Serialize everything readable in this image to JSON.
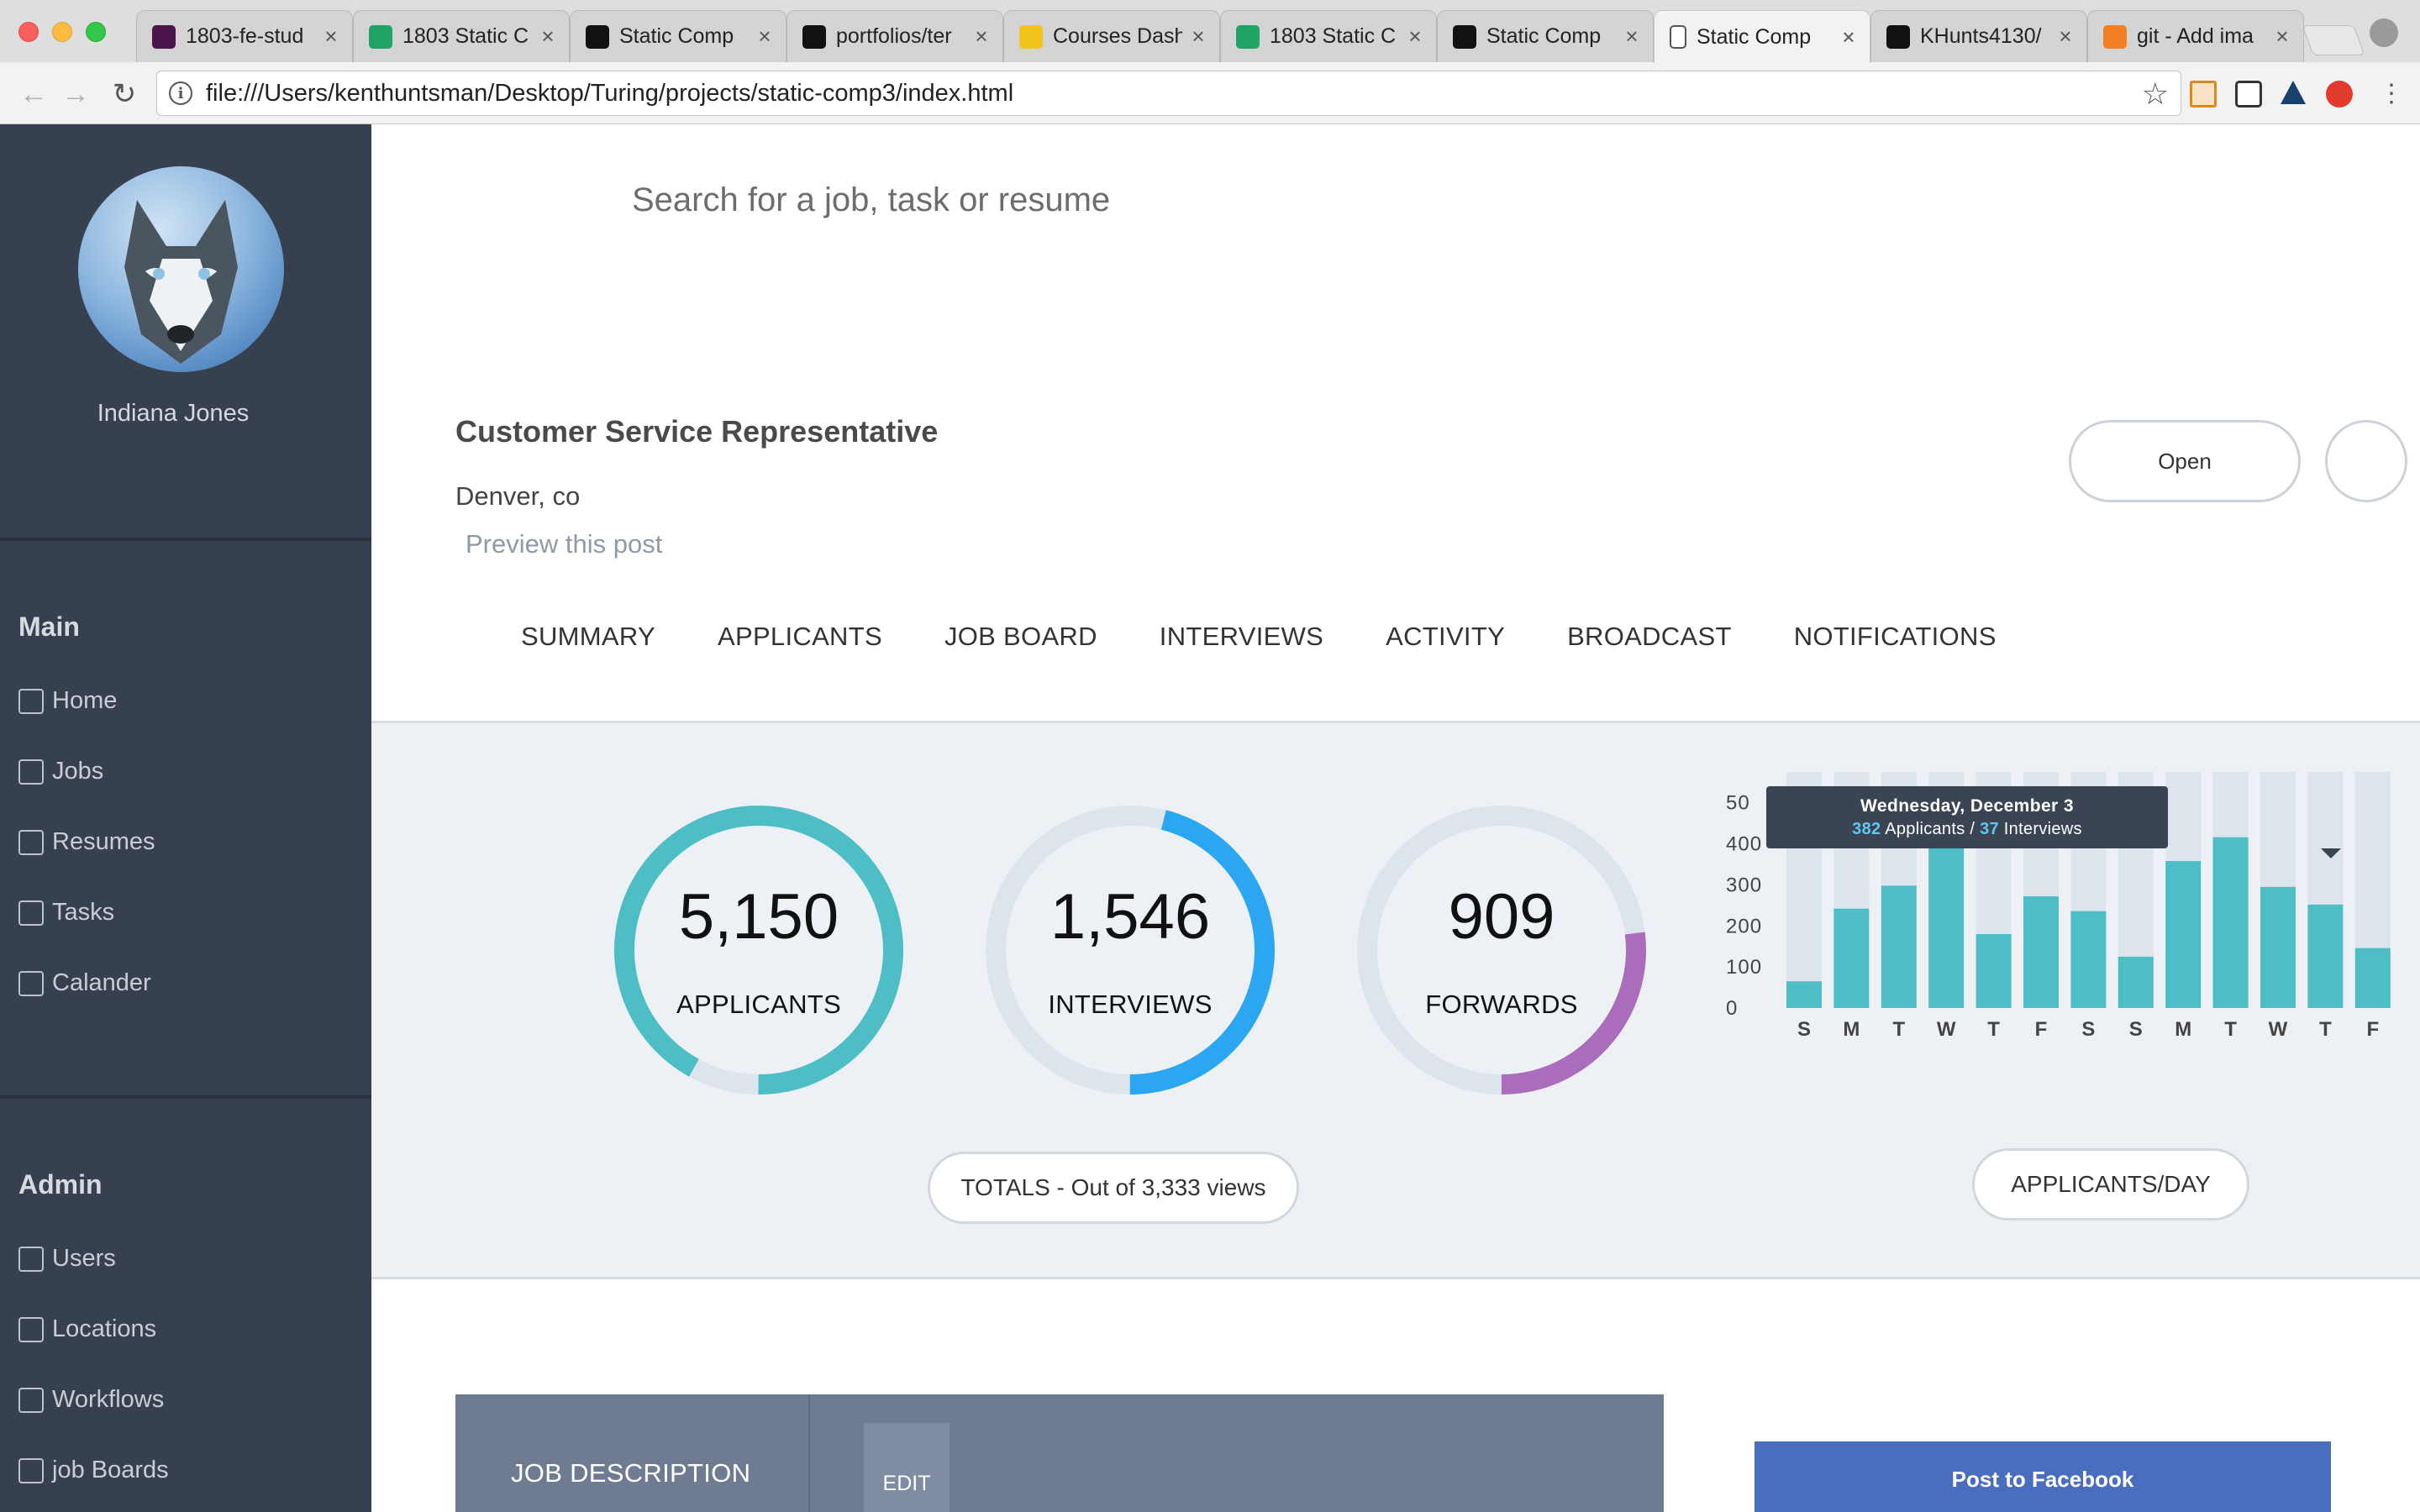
{
  "browser": {
    "tabs": [
      {
        "title": "1803-fe-stud",
        "icon": "slack-icon",
        "color": "#4a154b",
        "active": false
      },
      {
        "title": "1803 Static C",
        "icon": "sheets-icon",
        "color": "#21a464",
        "active": false
      },
      {
        "title": "Static Comp",
        "icon": "turing-icon",
        "color": "#111111",
        "active": false
      },
      {
        "title": "portfolios/ter",
        "icon": "github-icon",
        "color": "#111111",
        "active": false
      },
      {
        "title": "Courses Dash",
        "icon": "crown-icon",
        "color": "#f0c419",
        "active": false
      },
      {
        "title": "1803 Static C",
        "icon": "sheets-icon",
        "color": "#21a464",
        "active": false
      },
      {
        "title": "Static Comp",
        "icon": "turing-icon",
        "color": "#111111",
        "active": false
      },
      {
        "title": "Static Comp",
        "icon": "file-icon",
        "color": "#ffffff",
        "active": true
      },
      {
        "title": "KHunts4130/",
        "icon": "github-icon",
        "color": "#111111",
        "active": false
      },
      {
        "title": "git - Add ima",
        "icon": "stackoverflow-icon",
        "color": "#f48024",
        "active": false
      }
    ],
    "url": "file:///Users/kenthuntsman/Desktop/Turing/projects/static-comp3/index.html"
  },
  "sidebar": {
    "user_name": "Indiana Jones",
    "main_heading": "Main",
    "main_items": [
      {
        "label": "Home",
        "icon": "home-icon"
      },
      {
        "label": "Jobs",
        "icon": "briefcase-icon"
      },
      {
        "label": "Resumes",
        "icon": "resume-icon"
      },
      {
        "label": "Tasks",
        "icon": "tasks-icon"
      },
      {
        "label": "Calander",
        "icon": "calendar-icon"
      }
    ],
    "admin_heading": "Admin",
    "admin_items": [
      {
        "label": "Users",
        "icon": "user-icon"
      },
      {
        "label": "Locations",
        "icon": "location-pin-icon"
      },
      {
        "label": "Workflows",
        "icon": "sitemap-icon"
      },
      {
        "label": "job Boards",
        "icon": "clipboard-icon"
      }
    ]
  },
  "search": {
    "placeholder": "Search for a job, task or resume"
  },
  "job": {
    "title": "Customer Service Representative",
    "location": "Denver, co",
    "preview_link": "Preview this post",
    "status_button": "Open"
  },
  "tabs": [
    "SUMMARY",
    "APPLICANTS",
    "JOB BOARD",
    "INTERVIEWS",
    "ACTIVITY",
    "BROADCAST",
    "NOTIFICATIONS"
  ],
  "stats": [
    {
      "value": "5,150",
      "label": "APPLICANTS",
      "fraction": 0.92,
      "color": "#4dbec5"
    },
    {
      "value": "1,546",
      "label": "INTERVIEWS",
      "fraction": 0.46,
      "color": "#2aa7f0"
    },
    {
      "value": "909",
      "label": "FORWARDS",
      "fraction": 0.27,
      "color": "#aa6dbb"
    }
  ],
  "stats_track_color": "#dde5ec",
  "totals_button": "TOTALS - Out of 3,333 views",
  "perday_button": "APPLICANTS/DAY",
  "chart_data": {
    "type": "bar",
    "categories": [
      "S",
      "M",
      "T",
      "W",
      "T",
      "F",
      "S",
      "S",
      "M",
      "T",
      "W",
      "T",
      "F"
    ],
    "values": [
      65,
      242,
      298,
      410,
      180,
      272,
      236,
      125,
      358,
      416,
      295,
      252,
      146
    ],
    "ylim": [
      0,
      575
    ],
    "yticks": [
      "0",
      "100",
      "200",
      "300",
      "400",
      "50"
    ],
    "bar_color": "#4dbec5",
    "track_color": "#dde5ec",
    "tooltip": {
      "title": "Wednesday, December 3",
      "applicants": "382",
      "applicants_label": "Applicants /",
      "interviews": "37",
      "interviews_label": "Interviews"
    }
  },
  "job_panel": {
    "heading": "JOB DESCRIPTION",
    "edit_button": "EDIT",
    "facebook_button": "Post to Facebook"
  }
}
